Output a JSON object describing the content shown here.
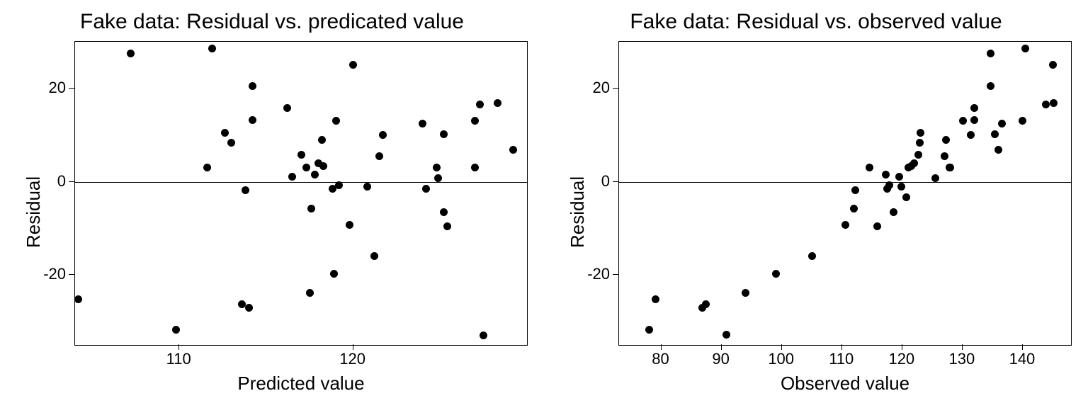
{
  "chart_data": [
    {
      "type": "scatter",
      "title": "Fake data: Residual vs. predicated value",
      "xlabel": "Predicted value",
      "ylabel": "Residual",
      "xlim": [
        104,
        130
      ],
      "ylim": [
        -35,
        30
      ],
      "xticks": [
        110,
        120
      ],
      "yticks": [
        -20,
        0,
        20
      ],
      "hline": 0,
      "points": [
        [
          104.2,
          -25.2
        ],
        [
          107.2,
          27.5
        ],
        [
          109.8,
          -31.7
        ],
        [
          111.6,
          3.0
        ],
        [
          111.9,
          28.5
        ],
        [
          112.6,
          10.5
        ],
        [
          113.0,
          8.3
        ],
        [
          113.6,
          -26.2
        ],
        [
          113.8,
          -1.8
        ],
        [
          114.0,
          -27.0
        ],
        [
          114.2,
          13.2
        ],
        [
          114.2,
          20.5
        ],
        [
          116.2,
          15.8
        ],
        [
          116.5,
          1.0
        ],
        [
          117.0,
          5.8
        ],
        [
          117.3,
          3.0
        ],
        [
          117.5,
          -23.8
        ],
        [
          117.6,
          -5.8
        ],
        [
          117.8,
          1.5
        ],
        [
          118.0,
          4.0
        ],
        [
          118.2,
          9.0
        ],
        [
          118.3,
          3.3
        ],
        [
          118.8,
          -1.5
        ],
        [
          118.9,
          -19.8
        ],
        [
          119.0,
          13.0
        ],
        [
          119.2,
          -0.8
        ],
        [
          119.8,
          -9.3
        ],
        [
          120.0,
          25.0
        ],
        [
          120.8,
          -1.0
        ],
        [
          121.2,
          -16.0
        ],
        [
          121.5,
          5.5
        ],
        [
          121.7,
          10.0
        ],
        [
          124.0,
          12.5
        ],
        [
          124.2,
          -1.5
        ],
        [
          124.8,
          3.0
        ],
        [
          124.9,
          0.8
        ],
        [
          125.2,
          10.2
        ],
        [
          125.2,
          -6.5
        ],
        [
          125.4,
          -9.6
        ],
        [
          127.0,
          3.0
        ],
        [
          127.0,
          13.0
        ],
        [
          127.3,
          16.5
        ],
        [
          127.5,
          -33.0
        ],
        [
          128.3,
          16.8
        ],
        [
          129.2,
          6.8
        ]
      ]
    },
    {
      "type": "scatter",
      "title": "Fake data: Residual vs. observed value",
      "xlabel": "Observed value",
      "ylabel": "Residual",
      "xlim": [
        73,
        148
      ],
      "ylim": [
        -35,
        30
      ],
      "xticks": [
        80,
        90,
        100,
        110,
        120,
        130,
        140
      ],
      "yticks": [
        -20,
        0,
        20
      ],
      "hline": 0,
      "points": [
        [
          78.0,
          -31.7
        ],
        [
          79.0,
          -25.2
        ],
        [
          86.8,
          -27.0
        ],
        [
          87.4,
          -26.2
        ],
        [
          90.8,
          -32.8
        ],
        [
          94.0,
          -23.8
        ],
        [
          99.0,
          -19.8
        ],
        [
          105.0,
          -16.0
        ],
        [
          110.5,
          -9.3
        ],
        [
          112.0,
          -5.8
        ],
        [
          112.2,
          -1.8
        ],
        [
          114.5,
          3.0
        ],
        [
          115.8,
          -9.6
        ],
        [
          117.3,
          1.5
        ],
        [
          117.5,
          -1.5
        ],
        [
          117.8,
          -0.8
        ],
        [
          118.6,
          -6.5
        ],
        [
          119.5,
          1.0
        ],
        [
          119.8,
          -1.0
        ],
        [
          120.7,
          -3.3
        ],
        [
          121.0,
          3.0
        ],
        [
          121.5,
          3.3
        ],
        [
          122.0,
          4.0
        ],
        [
          122.7,
          5.8
        ],
        [
          122.9,
          8.3
        ],
        [
          123.0,
          10.5
        ],
        [
          125.5,
          0.8
        ],
        [
          127.0,
          5.5
        ],
        [
          127.2,
          9.0
        ],
        [
          127.8,
          3.0
        ],
        [
          128.0,
          3.0
        ],
        [
          130.1,
          13.0
        ],
        [
          131.4,
          10.0
        ],
        [
          132.0,
          15.8
        ],
        [
          132.0,
          13.2
        ],
        [
          134.7,
          27.5
        ],
        [
          134.7,
          20.5
        ],
        [
          135.4,
          10.2
        ],
        [
          136.0,
          6.8
        ],
        [
          136.5,
          12.5
        ],
        [
          140.0,
          13.0
        ],
        [
          140.4,
          28.5
        ],
        [
          143.8,
          16.5
        ],
        [
          145.0,
          25.0
        ],
        [
          145.1,
          16.8
        ]
      ]
    }
  ]
}
